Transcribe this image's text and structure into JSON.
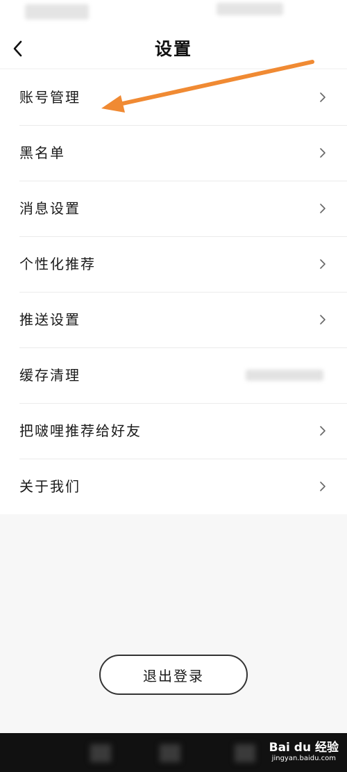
{
  "header": {
    "title": "设置"
  },
  "menu": {
    "items": [
      {
        "label": "账号管理"
      },
      {
        "label": "黑名单"
      },
      {
        "label": "消息设置"
      },
      {
        "label": "个性化推荐"
      },
      {
        "label": "推送设置"
      },
      {
        "label": "缓存清理"
      },
      {
        "label": "把啵哩推荐给好友"
      },
      {
        "label": "关于我们"
      }
    ]
  },
  "logout": {
    "label": "退出登录"
  },
  "watermark": {
    "text": "Bai du 经验",
    "url": "jingyan.baidu.com"
  },
  "colors": {
    "annotation_arrow": "#f08a33",
    "bottom_bar": "#111111"
  }
}
